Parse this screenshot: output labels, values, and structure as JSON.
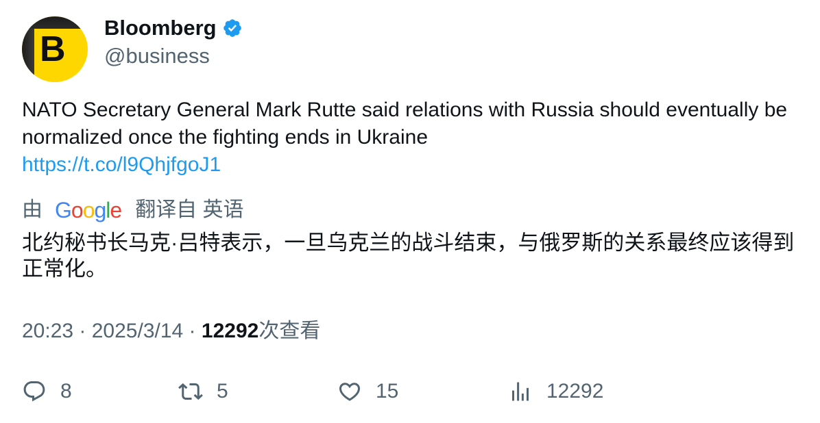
{
  "author": {
    "name": "Bloomberg",
    "handle": "@business",
    "avatar_letter": "B",
    "verified": true
  },
  "tweet": {
    "text": "NATO Secretary General Mark Rutte said relations with Russia should eventually be normalized once the fighting ends in Ukraine",
    "link": "https://t.co/l9QhjfgoJ1"
  },
  "translation": {
    "by_label": "由",
    "provider": "Google",
    "from_label": "翻译自 英语",
    "text": "北约秘书长马克·吕特表示，一旦乌克兰的战斗结束，与俄罗斯的关系最终应该得到正常化。"
  },
  "meta": {
    "time": "20:23",
    "separator": " · ",
    "date": "2025/3/14",
    "views_count": "12292",
    "views_label": "次查看"
  },
  "actions": {
    "replies": "8",
    "retweets": "5",
    "likes": "15",
    "views": "12292"
  },
  "colors": {
    "link": "#1d9bf0",
    "secondary_text": "#536471",
    "primary_text": "#0f1419",
    "verified": "#1d9bf0",
    "avatar_bg": "#ffd700"
  }
}
